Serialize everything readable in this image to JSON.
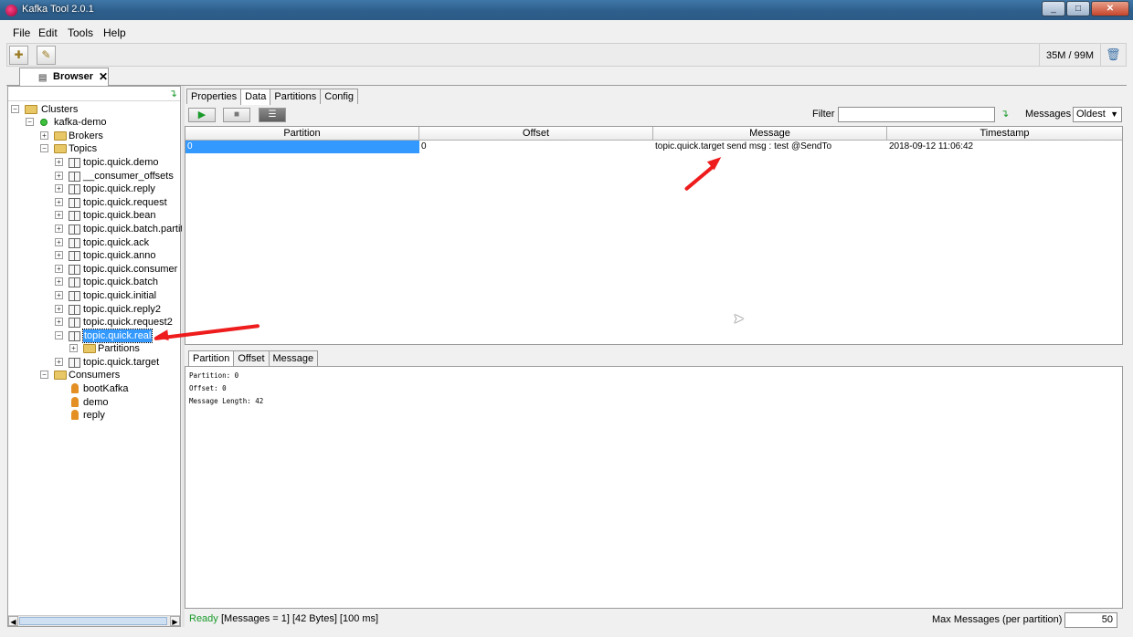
{
  "window": {
    "title": "Kafka Tool  2.0.1",
    "min": "_",
    "max": "□",
    "close": "✕"
  },
  "menu": {
    "file": "File",
    "edit": "Edit",
    "tools": "Tools",
    "help": "Help"
  },
  "toolbar": {
    "memory": "35M / 99M"
  },
  "main_tab": {
    "label": "Browser",
    "close": "✕"
  },
  "tree": {
    "clusters": "Clusters",
    "cluster": "kafka-demo",
    "brokers": "Brokers",
    "topics": "Topics",
    "topic_list": [
      "topic.quick.demo",
      "__consumer_offsets",
      "topic.quick.reply",
      "topic.quick.request",
      "topic.quick.bean",
      "topic.quick.batch.partit",
      "topic.quick.ack",
      "topic.quick.anno",
      "topic.quick.consumer",
      "topic.quick.batch",
      "topic.quick.initial",
      "topic.quick.reply2",
      "topic.quick.request2",
      "topic.quick.real"
    ],
    "partitions": "Partitions",
    "last_topic": "topic.quick.target",
    "consumers": "Consumers",
    "consumer_list": [
      "bootKafka",
      "demo",
      "reply"
    ]
  },
  "data_tabs": [
    "Properties",
    "Data",
    "Partitions",
    "Config"
  ],
  "controls": {
    "filter_label": "Filter",
    "filter_value": "",
    "messages_label": "Messages",
    "messages_value": "Oldest"
  },
  "grid": {
    "columns": [
      "Partition",
      "Offset",
      "Message",
      "Timestamp"
    ],
    "rows": [
      [
        "0",
        "0",
        "topic.quick.target send msg : test @SendTo",
        "2018-09-12 11:06:42"
      ]
    ]
  },
  "detail_tabs": [
    "Partition",
    "Offset",
    "Message"
  ],
  "detail_lines": [
    "Partition: 0",
    "Offset: 0",
    "Message Length: 42"
  ],
  "status": {
    "ready": "Ready",
    "info": "[Messages = 1]  [42 Bytes]  [100 ms]",
    "max_label": "Max Messages (per partition)",
    "max_value": "50"
  },
  "colors": {
    "selection": "#3399ff",
    "arrow": "#ee1c1c",
    "ready": "#1a9a2a"
  }
}
